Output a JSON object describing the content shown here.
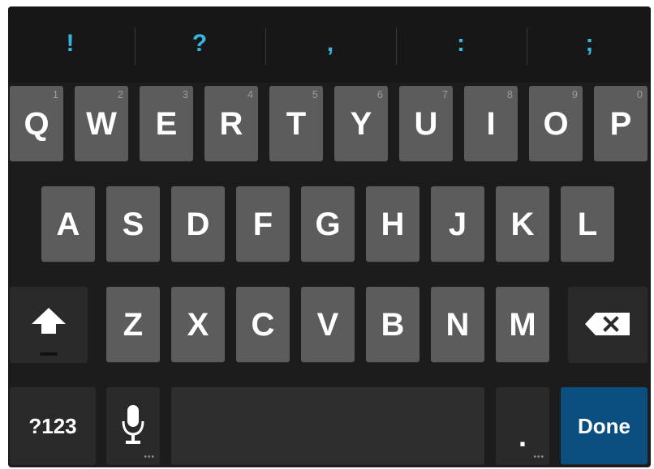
{
  "suggestions": [
    "!",
    "?",
    ",",
    ":",
    ";"
  ],
  "row1": [
    {
      "label": "Q",
      "num": "1"
    },
    {
      "label": "W",
      "num": "2"
    },
    {
      "label": "E",
      "num": "3"
    },
    {
      "label": "R",
      "num": "4"
    },
    {
      "label": "T",
      "num": "5"
    },
    {
      "label": "Y",
      "num": "6"
    },
    {
      "label": "U",
      "num": "7"
    },
    {
      "label": "I",
      "num": "8"
    },
    {
      "label": "O",
      "num": "9"
    },
    {
      "label": "P",
      "num": "0"
    }
  ],
  "row2": [
    "A",
    "S",
    "D",
    "F",
    "G",
    "H",
    "J",
    "K",
    "L"
  ],
  "row3": [
    "Z",
    "X",
    "C",
    "V",
    "B",
    "N",
    "M"
  ],
  "bottom": {
    "symbols_label": "?123",
    "period_label": ".",
    "done_label": "Done"
  },
  "icons": {
    "shift": "shift-arrow-icon",
    "backspace": "backspace-icon",
    "mic": "microphone-icon"
  },
  "colors": {
    "key": "#5c5c5c",
    "background": "#1c1c1c",
    "suggestion_text": "#35b7e0",
    "done_key": "#0b4f80"
  }
}
